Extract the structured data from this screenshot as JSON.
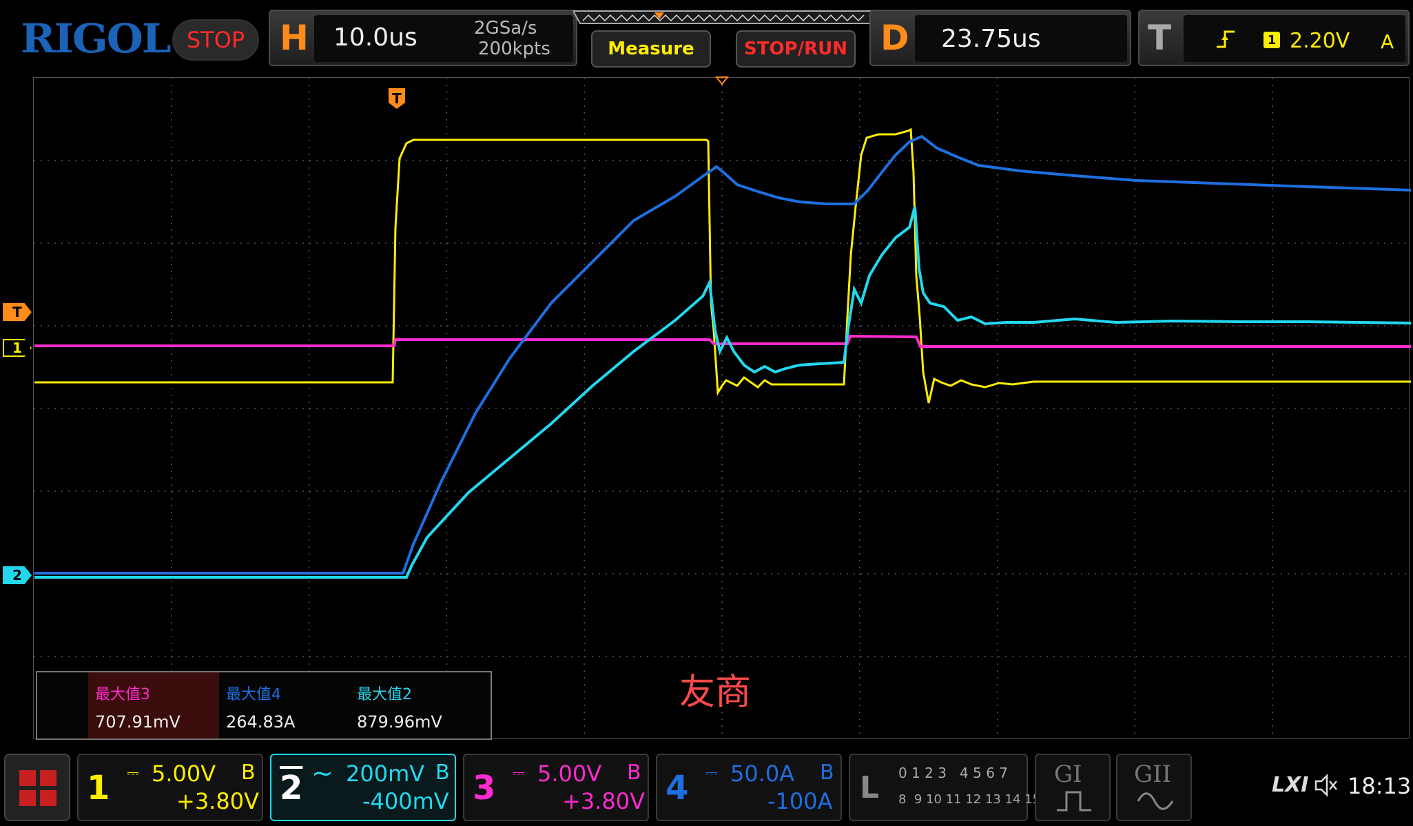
{
  "brand": "RIGOL",
  "status": "STOP",
  "horizontal": {
    "letter": "H",
    "timebase": "10.0us",
    "sample_rate": "2GSa/s",
    "memory_depth": "200kpts"
  },
  "buttons": {
    "measure": "Measure",
    "stop_run": "STOP/RUN"
  },
  "delay": {
    "letter": "D",
    "value": "23.75us"
  },
  "trigger": {
    "letter": "T",
    "source": "1",
    "level": "2.20V",
    "mode": "A"
  },
  "markers": {
    "trigger_pos": "T",
    "trigger_level": "T",
    "ch1": "1",
    "ch2": "2"
  },
  "measurements": [
    {
      "label": "最大值3",
      "value": "707.91mV",
      "color": "#ff2bd0"
    },
    {
      "label": "最大值4",
      "value": "264.83A",
      "color": "#1e6fe0"
    },
    {
      "label": "最大值2",
      "value": "879.96mV",
      "color": "#2ad4e8"
    }
  ],
  "annotation": "友商",
  "channels": [
    {
      "num": "1",
      "scale": "5.00V",
      "offset": "+3.80V",
      "bw": "B",
      "color": "#ffee00",
      "coupling_icon": "dc-icon"
    },
    {
      "num": "2",
      "scale": "200mV",
      "offset": "-400mV",
      "bw": "B",
      "color": "#22d8ef",
      "coupling_icon": "ac-icon"
    },
    {
      "num": "3",
      "scale": "5.00V",
      "offset": "+3.80V",
      "bw": "B",
      "color": "#ff2bd0",
      "coupling_icon": "dc-icon"
    },
    {
      "num": "4",
      "scale": "50.0A",
      "offset": "-100A",
      "bw": "B",
      "color": "#1e6fe0",
      "coupling_icon": "dc-icon"
    }
  ],
  "logic": {
    "letter": "L",
    "row1": "0 1 2 3   4 5 6 7",
    "row2": "8  9 10 11 12 13 14 15"
  },
  "generators": {
    "g1": "GI",
    "g2": "GII"
  },
  "system": {
    "lxi": "LXI",
    "time": "18:13"
  }
}
